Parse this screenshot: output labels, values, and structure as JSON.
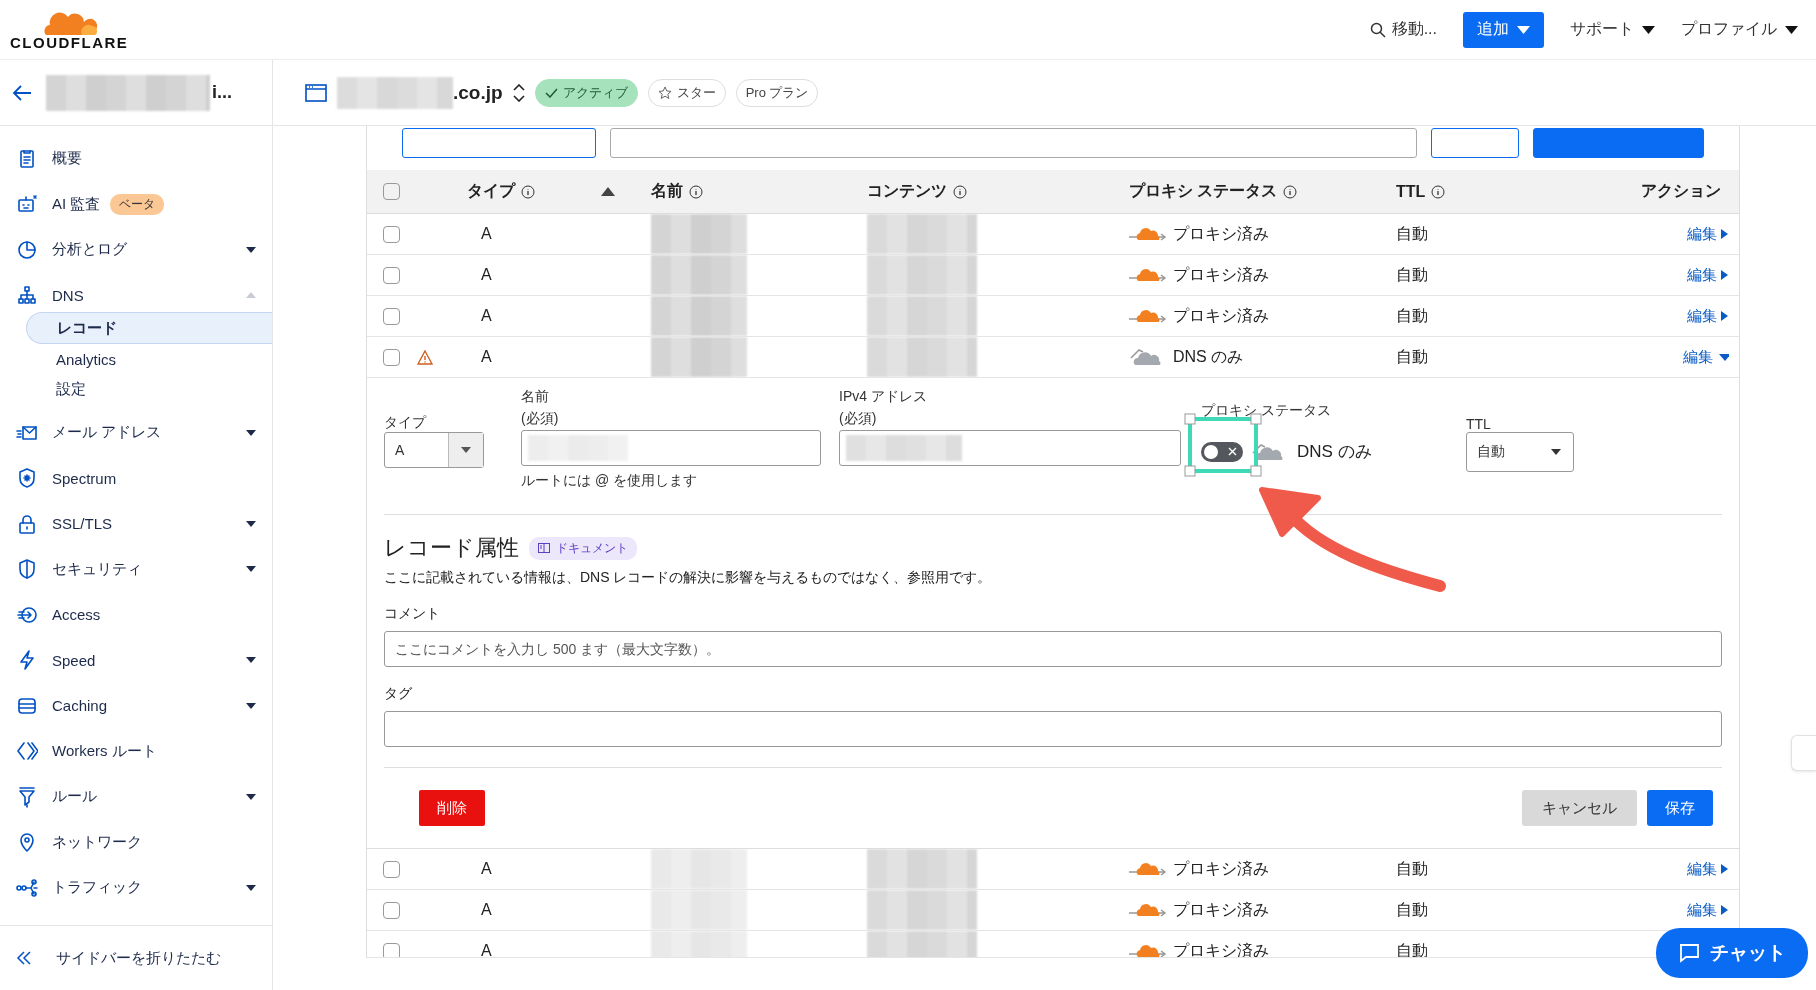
{
  "brand": {
    "name": "CLOUDFLARE"
  },
  "top_nav": {
    "search": "移動...",
    "add_button": "追加",
    "menus": [
      "サポート",
      "プロファイル"
    ]
  },
  "account": {
    "name_tail": "i..."
  },
  "zone": {
    "domain_tail": ".co.jp",
    "status": "アクティブ",
    "star": "スター",
    "plan": "Pro プラン"
  },
  "sidebar": {
    "items": [
      {
        "label": "概要"
      },
      {
        "label": "AI 監査",
        "badge": "ベータ"
      },
      {
        "label": "分析とログ",
        "expanded": false
      },
      {
        "label": "DNS",
        "expanded": true,
        "children": [
          {
            "label": "レコード",
            "selected": true
          },
          {
            "label": "Analytics",
            "selected": false
          },
          {
            "label": "設定",
            "selected": false
          }
        ]
      },
      {
        "label": "メール アドレス",
        "expanded": false
      },
      {
        "label": "Spectrum"
      },
      {
        "label": "SSL/TLS",
        "expanded": false
      },
      {
        "label": "セキュリティ",
        "expanded": false
      },
      {
        "label": "Access"
      },
      {
        "label": "Speed",
        "expanded": false
      },
      {
        "label": "Caching",
        "expanded": false
      },
      {
        "label": "Workers ルート"
      },
      {
        "label": "ルール",
        "expanded": false
      },
      {
        "label": "ネットワーク"
      },
      {
        "label": "トラフィック",
        "expanded": false
      }
    ],
    "collapse": "サイドバーを折りたたむ"
  },
  "table": {
    "all_checked": false,
    "columns": [
      {
        "label": "タイプ",
        "info": true,
        "sorted": true
      },
      {
        "label": "名前",
        "info": true,
        "sorted": false
      },
      {
        "label": "コンテンツ",
        "info": true,
        "sorted": false
      },
      {
        "label": "プロキシ ステータス",
        "info": true,
        "sorted": false
      },
      {
        "label": "TTL",
        "info": true,
        "sorted": false
      },
      {
        "label": "アクション",
        "info": false,
        "sorted": false
      }
    ],
    "rows_before": [
      {
        "checked": false,
        "type": "A",
        "kind": "proxied",
        "proxy_label": "プロキシ済み",
        "ttl": "自動",
        "action": "編集",
        "expanded": false,
        "warning": false
      },
      {
        "checked": false,
        "type": "A",
        "kind": "proxied",
        "proxy_label": "プロキシ済み",
        "ttl": "自動",
        "action": "編集",
        "expanded": false,
        "warning": false
      },
      {
        "checked": false,
        "type": "A",
        "kind": "proxied",
        "proxy_label": "プロキシ済み",
        "ttl": "自動",
        "action": "編集",
        "expanded": false,
        "warning": false
      },
      {
        "checked": false,
        "type": "A",
        "kind": "dns_only",
        "proxy_label": "DNS のみ",
        "ttl": "自動",
        "action": "編集",
        "expanded": true,
        "warning": true
      }
    ],
    "rows_after": [
      {
        "checked": false,
        "type": "A",
        "kind": "proxied",
        "proxy_label": "プロキシ済み",
        "ttl": "自動",
        "action": "編集",
        "expanded": false,
        "warning": false
      },
      {
        "checked": false,
        "type": "A",
        "kind": "proxied",
        "proxy_label": "プロキシ済み",
        "ttl": "自動",
        "action": "編集",
        "expanded": false,
        "warning": false
      },
      {
        "checked": false,
        "type": "A",
        "kind": "proxied",
        "proxy_label": "プロキシ済み",
        "ttl": "自動",
        "warning": false
      }
    ]
  },
  "edit_form": {
    "type_label": "タイプ",
    "type_value": "A",
    "name_label": "名前",
    "name_required": "(必須)",
    "name_hint": "ルートには @ を使用します",
    "address_label": "IPv4 アドレス",
    "address_required": "(必須)",
    "proxy_label": "プロキシ ステータス",
    "proxy_on": false,
    "proxy_text": "DNS のみ",
    "ttl_label": "TTL",
    "ttl_value": "自動",
    "attributes_title": "レコード属性",
    "doc_link": "ドキュメント",
    "description": "ここに記載されている情報は、DNS レコードの解決に影響を与えるものではなく、参照用です。",
    "comment_label": "コメント",
    "comment_placeholder": "ここにコメントを入力し 500 ます（最大文字数）。",
    "tag_label": "タグ",
    "delete": "削除",
    "cancel": "キャンセル",
    "save": "保存"
  },
  "chat": {
    "label": "チャット"
  }
}
